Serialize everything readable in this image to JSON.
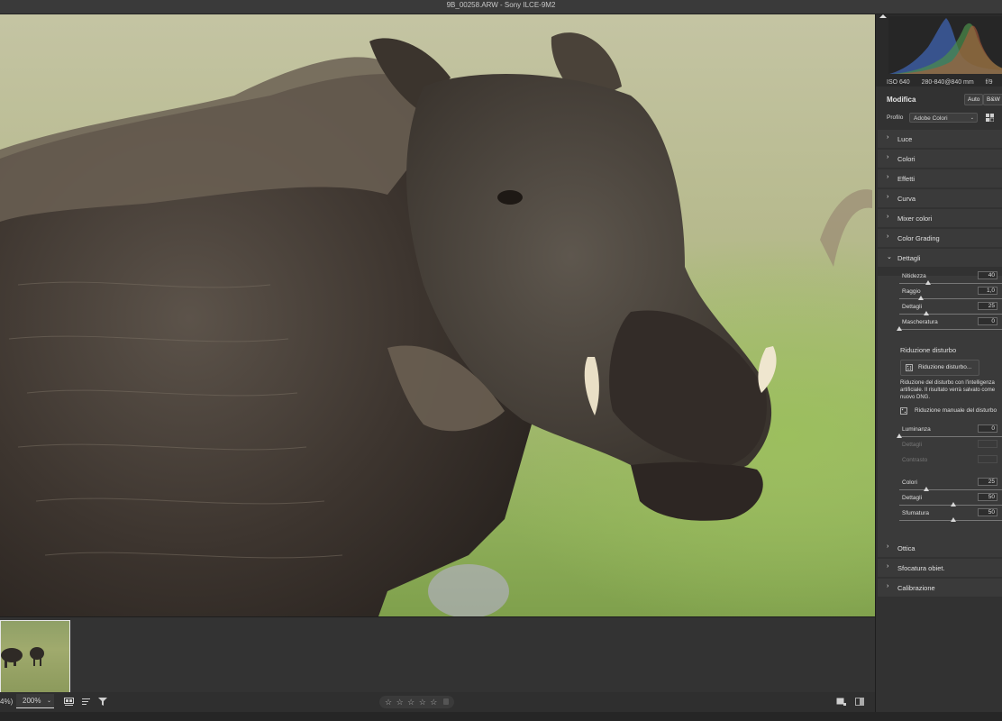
{
  "window": {
    "title": "9B_00258.ARW  -  Sony ILCE-9M2"
  },
  "filmstrip": {
    "zoom_fit": "4%)",
    "zoom_level": "200%"
  },
  "rating": {
    "stars": "☆ ☆ ☆ ☆ ☆"
  },
  "camera_info": {
    "iso": "ISO 640",
    "lens": "280-840@840 mm",
    "aperture": "f/9"
  },
  "edit": {
    "title": "Modifica",
    "auto_label": "Auto",
    "bw_label": "B&W",
    "profile_label": "Profilo",
    "profile_value": "Adobe Colori"
  },
  "sections": {
    "luce": "Luce",
    "colori": "Colori",
    "effetti": "Effetti",
    "curva": "Curva",
    "mixer": "Mixer colori",
    "grading": "Color Grading",
    "dettagli": "Dettagli",
    "ottica": "Ottica",
    "sfocatura": "Sfocatura obiet.",
    "calibrazione": "Calibrazione"
  },
  "sharpening": [
    {
      "label": "Nitidezza",
      "value": "40",
      "level": 0.27
    },
    {
      "label": "Raggio",
      "value": "1,0",
      "level": 0.2
    },
    {
      "label": "Dettagli",
      "value": "25",
      "level": 0.25
    },
    {
      "label": "Mascheratura",
      "value": "0",
      "level": 0.0
    }
  ],
  "noise": {
    "title": "Riduzione disturbo",
    "ai_button": "Riduzione disturbo...",
    "description": "Riduzione del disturbo con l'intelligenza artificiale. Il risultato verrà salvato come nuovo DNG.",
    "manual_label": "Riduzione manuale del disturbo",
    "sliders": [
      {
        "label": "Luminanza",
        "value": "0",
        "level": 0.0,
        "disabled": false
      },
      {
        "label": "Dettagli",
        "value": "",
        "level": 0.5,
        "disabled": true
      },
      {
        "label": "Contrasto",
        "value": "",
        "level": 0.0,
        "disabled": true
      },
      {
        "label": "Colori",
        "value": "25",
        "level": 0.25,
        "disabled": false
      },
      {
        "label": "Dettagli",
        "value": "50",
        "level": 0.5,
        "disabled": false
      },
      {
        "label": "Sfumatura",
        "value": "50",
        "level": 0.5,
        "disabled": false
      }
    ]
  }
}
